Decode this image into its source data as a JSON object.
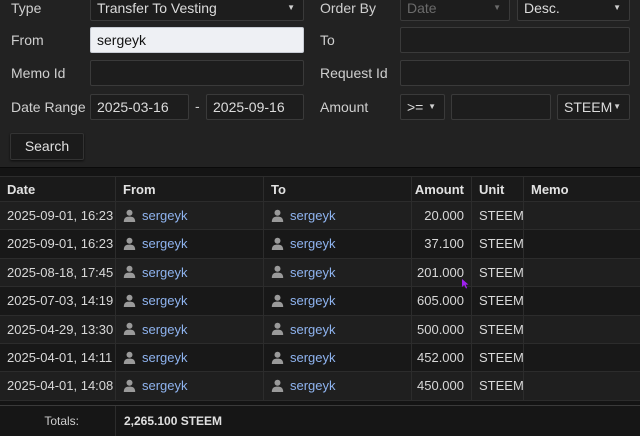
{
  "filters": {
    "type_label": "Type",
    "type_value": "Transfer To Vesting",
    "from_label": "From",
    "from_value": "sergeyk",
    "memo_label": "Memo Id",
    "memo_value": "",
    "date_range_label": "Date Range",
    "date_from": "2025-03-16",
    "date_sep": "-",
    "date_to": "2025-09-16",
    "order_by_label": "Order By",
    "order_by_value": "Date",
    "order_dir_value": "Desc.",
    "to_label": "To",
    "to_value": "",
    "request_label": "Request Id",
    "request_value": "",
    "amount_label": "Amount",
    "amount_op": ">=",
    "amount_value": "",
    "amount_unit": "STEEM",
    "search_label": "Search"
  },
  "table": {
    "headers": {
      "date": "Date",
      "from": "From",
      "to": "To",
      "amount": "Amount",
      "unit": "Unit",
      "memo": "Memo"
    },
    "rows": [
      {
        "date": "2025-09-01, 16:23",
        "from": "sergeyk",
        "to": "sergeyk",
        "amount": "20.000",
        "unit": "STEEM",
        "memo": ""
      },
      {
        "date": "2025-09-01, 16:23",
        "from": "sergeyk",
        "to": "sergeyk",
        "amount": "37.100",
        "unit": "STEEM",
        "memo": ""
      },
      {
        "date": "2025-08-18, 17:45",
        "from": "sergeyk",
        "to": "sergeyk",
        "amount": "201.000",
        "unit": "STEEM",
        "memo": ""
      },
      {
        "date": "2025-07-03, 14:19",
        "from": "sergeyk",
        "to": "sergeyk",
        "amount": "605.000",
        "unit": "STEEM",
        "memo": ""
      },
      {
        "date": "2025-04-29, 13:30",
        "from": "sergeyk",
        "to": "sergeyk",
        "amount": "500.000",
        "unit": "STEEM",
        "memo": ""
      },
      {
        "date": "2025-04-01, 14:11",
        "from": "sergeyk",
        "to": "sergeyk",
        "amount": "452.000",
        "unit": "STEEM",
        "memo": ""
      },
      {
        "date": "2025-04-01, 14:08",
        "from": "sergeyk",
        "to": "sergeyk",
        "amount": "450.000",
        "unit": "STEEM",
        "memo": ""
      }
    ],
    "totals_label": "Totals:",
    "totals_value": "2,265.100 STEEM"
  },
  "colors": {
    "link": "#8fb4f0",
    "cursor": "#a020f0"
  },
  "icons": {
    "user": "user-icon",
    "caret": "caret-down-icon",
    "cursor": "mouse-cursor-icon"
  }
}
